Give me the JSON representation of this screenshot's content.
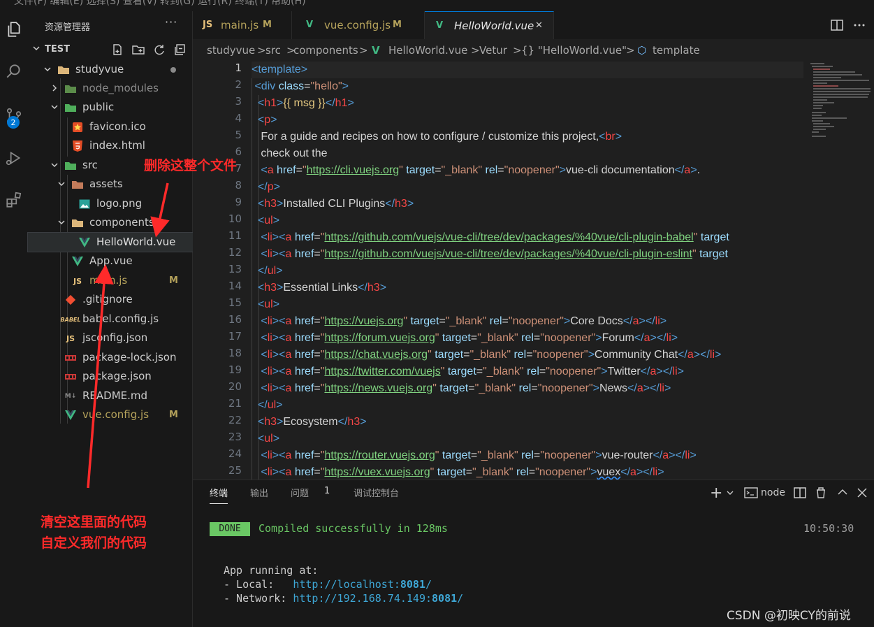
{
  "menubar": {
    "items": "文件(F)   编辑(E)   选择(S)   查看(V)   转到(G)   运行(R)   终端(T)   帮助(H)"
  },
  "activity_bar": {
    "scm_badge": "2"
  },
  "sidebar": {
    "title": "资源管理器",
    "more": "···",
    "section_title": "TEST",
    "tree": [
      {
        "label": "studyvue",
        "type": "folder-open"
      },
      {
        "label": "node_modules",
        "type": "folder"
      },
      {
        "label": "public",
        "type": "folder-open"
      },
      {
        "label": "favicon.ico",
        "type": "file"
      },
      {
        "label": "index.html",
        "type": "file"
      },
      {
        "label": "src",
        "type": "folder-open"
      },
      {
        "label": "assets",
        "type": "folder-open"
      },
      {
        "label": "logo.png",
        "type": "file"
      },
      {
        "label": "components",
        "type": "folder-open"
      },
      {
        "label": "HelloWorld.vue",
        "type": "file"
      },
      {
        "label": "App.vue",
        "type": "file"
      },
      {
        "label": "main.js",
        "type": "file",
        "badge": "M"
      },
      {
        "label": ".gitignore",
        "type": "file"
      },
      {
        "label": "babel.config.js",
        "type": "file"
      },
      {
        "label": "jsconfig.json",
        "type": "file"
      },
      {
        "label": "package-lock.json",
        "type": "file"
      },
      {
        "label": "package.json",
        "type": "file"
      },
      {
        "label": "README.md",
        "type": "file"
      },
      {
        "label": "vue.config.js",
        "type": "file",
        "badge": "M"
      }
    ]
  },
  "tabs": [
    {
      "icon_text": "JS",
      "label": "main.js",
      "badge": "M"
    },
    {
      "icon_text": "V",
      "label": "vue.config.js",
      "badge": "M"
    },
    {
      "icon_text": "V",
      "label": "HelloWorld.vue",
      "close": "✕"
    }
  ],
  "breadcrumb": {
    "items": [
      "studyvue",
      "src",
      "components",
      "HelloWorld.vue",
      "Vetur",
      "{} \"HelloWorld.vue\"",
      "template"
    ],
    "sep": ">"
  },
  "editor": {
    "line_numbers": [
      "1",
      "2",
      "3",
      "4",
      "5",
      "6",
      "7",
      "8",
      "9",
      "10",
      "11",
      "12",
      "13",
      "14",
      "15",
      "16",
      "17",
      "18",
      "19",
      "20",
      "21",
      "22",
      "23",
      "24",
      "25"
    ]
  },
  "panel": {
    "tabs": [
      "终端",
      "输出",
      "问题",
      "调试控制台"
    ],
    "problems_count": "1",
    "terminal_name": "node",
    "plus": "+",
    "done_label": "DONE",
    "compiled_msg": "Compiled successfully in 128ms",
    "time": "10:50:30",
    "running_at": "App running at:",
    "local_label": "- Local:   ",
    "local_url": "http://localhost:",
    "local_port": "8081",
    "local_slash": "/",
    "network_label": "- Network: ",
    "network_url": "http://192.168.74.149:",
    "network_port": "8081",
    "network_slash": "/"
  },
  "annotations": {
    "delete_file": "删除这整个文件",
    "clear_code_1": "清空这里面的代码",
    "clear_code_2": "自定义我们的代码"
  },
  "watermark": "CSDN @初映CY的前说",
  "colors": {
    "accent": "#0078d4",
    "annotation": "#ff2a2a",
    "done": "#6ac764",
    "modified": "#b5a25b"
  }
}
